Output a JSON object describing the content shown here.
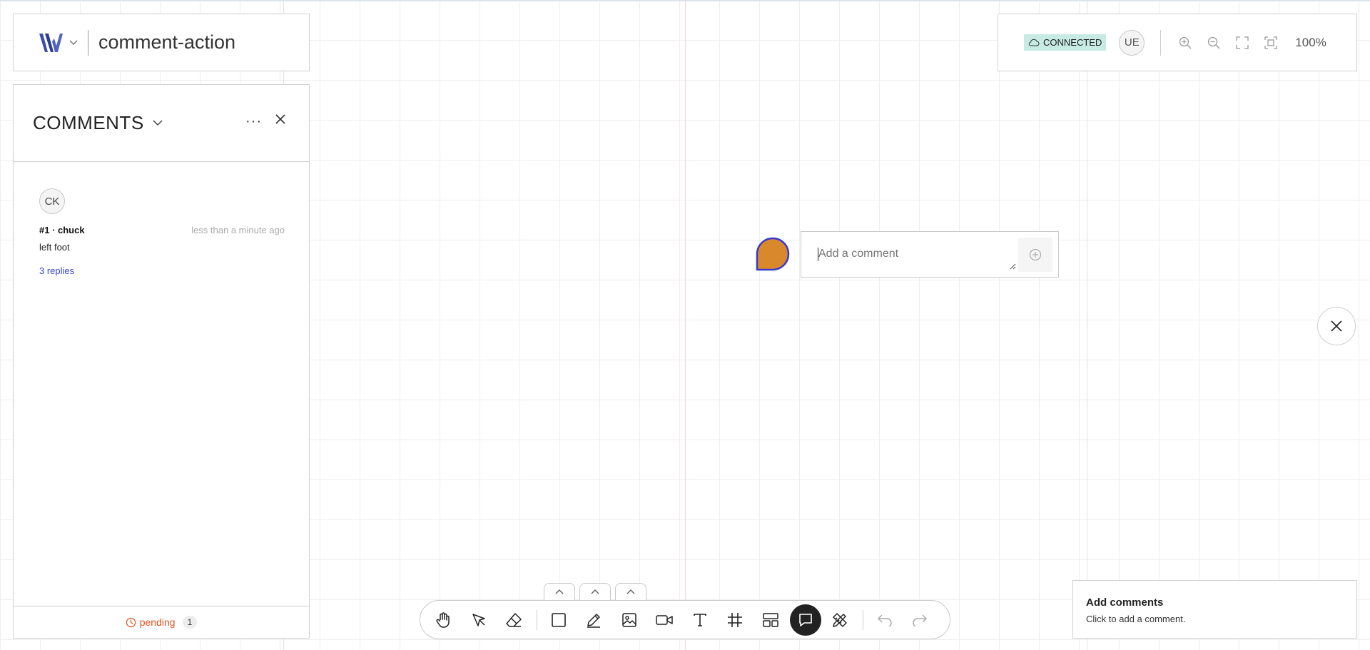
{
  "header": {
    "doc_title": "comment-action"
  },
  "comments_panel": {
    "title": "COMMENTS",
    "thread": {
      "avatar": "CK",
      "author": "#1 · chuck",
      "time": "less than a minute ago",
      "body": "left foot",
      "replies": "3 replies"
    },
    "footer": {
      "status": "pending",
      "count": "1"
    }
  },
  "topbar": {
    "connection": "CONNECTED",
    "user_avatar": "UE",
    "zoom": "100%"
  },
  "comment_input": {
    "placeholder": "Add a comment"
  },
  "pin": {
    "color": "#d9892b",
    "border": "#3a3ad0"
  },
  "toolbar": {
    "tools": [
      "hand-icon",
      "pointer-icon",
      "eraser-icon",
      "rectangle-icon",
      "pencil-icon",
      "image-icon",
      "video-icon",
      "text-icon",
      "frame-icon",
      "layout-icon",
      "comment-icon",
      "ruler-icon",
      "undo-icon",
      "redo-icon"
    ],
    "active": "comment-icon"
  },
  "hint": {
    "title": "Add comments",
    "body": "Click to add a comment."
  },
  "colors": {
    "accent_link": "#3a46d8",
    "pending": "#d9531e",
    "connected_bg": "#c7ebe2"
  }
}
